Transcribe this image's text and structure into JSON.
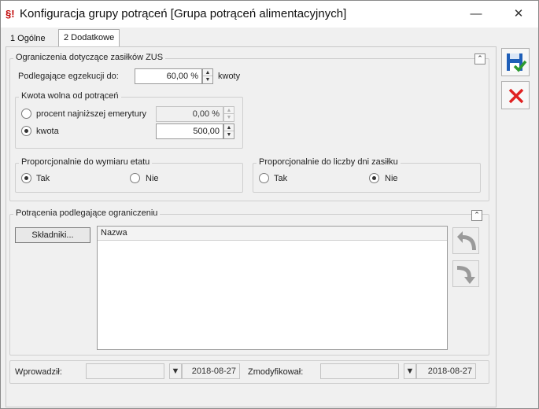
{
  "window": {
    "title": "Konfiguracja grupy potrąceń [Grupa potrąceń alimentacyjnych]",
    "app_icon_text": "§!"
  },
  "tabs": [
    {
      "label": "1 Ogólne"
    },
    {
      "label": "2 Dodatkowe"
    }
  ],
  "zus_group": {
    "title": "Ograniczenia dotyczące zasiłków ZUS",
    "egzekucja_label": "Podlegające egzekucji do:",
    "egzekucja_value": "60,00 %",
    "egzekucja_unit": "kwoty",
    "kwota_wolna": {
      "title": "Kwota wolna od potrąceń",
      "option_percent_label": "procent najniższej emerytury",
      "option_percent_value": "0,00 %",
      "option_kwota_label": "kwota",
      "option_kwota_value": "500,00",
      "selected": "kwota"
    },
    "etat": {
      "title": "Proporcjonalnie do wymiaru etatu",
      "yes": "Tak",
      "no": "Nie",
      "selected": "Tak"
    },
    "dni": {
      "title": "Proporcjonalnie do liczby dni zasiłku",
      "yes": "Tak",
      "no": "Nie",
      "selected": "Nie"
    }
  },
  "potracenia_group": {
    "title": "Potrącenia podlegające ograniczeniu",
    "skladniki_button": "Składniki...",
    "grid_header": "Nazwa"
  },
  "footer": {
    "wprowadzil_label": "Wprowadził:",
    "wprowadzil_value": "",
    "wprowadzil_date": "2018-08-27",
    "zmodyfikowal_label": "Zmodyfikował:",
    "zmodyfikowal_value": "",
    "zmodyfikowal_date": "2018-08-27"
  },
  "icons": {
    "save": "save-check-icon",
    "cancel": "red-x-icon",
    "move_up": "curved-arrow-up-icon",
    "move_down": "curved-arrow-down-icon"
  },
  "colors": {
    "save_blue": "#1f5fb8",
    "check_green": "#2e9a2e",
    "cancel_red": "#e02020"
  }
}
